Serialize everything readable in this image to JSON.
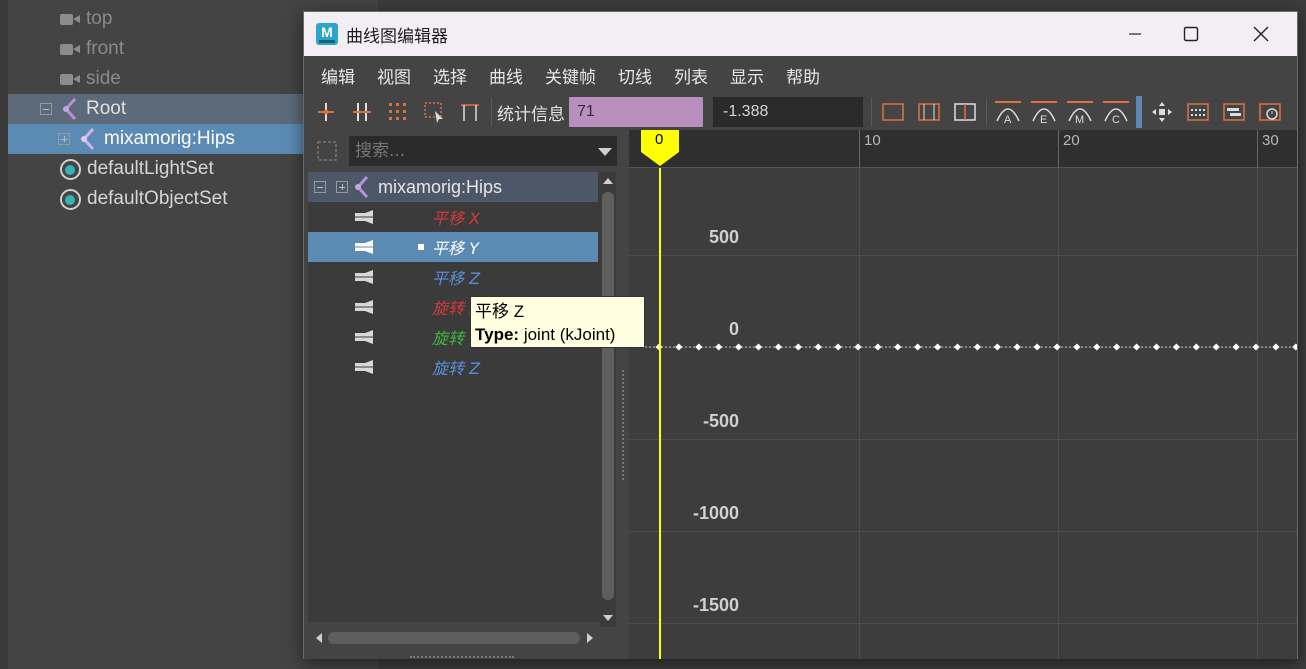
{
  "outliner": {
    "items": [
      {
        "label": "top",
        "kind": "camera"
      },
      {
        "label": "front",
        "kind": "camera"
      },
      {
        "label": "side",
        "kind": "camera"
      },
      {
        "label": "Root",
        "kind": "joint"
      },
      {
        "label": "mixamorig:Hips",
        "kind": "joint"
      },
      {
        "label": "defaultLightSet",
        "kind": "set"
      },
      {
        "label": "defaultObjectSet",
        "kind": "set"
      }
    ]
  },
  "window": {
    "title": "曲线图编辑器",
    "app_icon_letter": "M"
  },
  "menu": [
    "编辑",
    "视图",
    "选择",
    "曲线",
    "关键帧",
    "切线",
    "列表",
    "显示",
    "帮助"
  ],
  "toolbar": {
    "stats_label": "统计信息",
    "frame_value": "71",
    "value_field": "-1.388"
  },
  "search": {
    "placeholder": "搜索..."
  },
  "tree": {
    "node": "mixamorig:Hips",
    "attributes": [
      {
        "label": "平移 X",
        "color": "#d63a3a"
      },
      {
        "label": "平移 Y",
        "color": "#ffffff"
      },
      {
        "label": "平移 Z",
        "color": "#5a8fd6"
      },
      {
        "label": "旋转 X",
        "color": "#d63a3a"
      },
      {
        "label": "旋转 Y",
        "color": "#3fb53f"
      },
      {
        "label": "旋转 Z",
        "color": "#5a8fd6"
      }
    ],
    "selected_index": 1
  },
  "tooltip": {
    "name": "平移 Z",
    "type_label": "Type:",
    "type_value": "joint (kJoint)"
  },
  "graph": {
    "current_frame": "0",
    "ruler_labels": [
      "10",
      "20",
      "30"
    ],
    "y_labels": [
      "500",
      "0",
      "-500",
      "-1000",
      "-1500"
    ],
    "colors": {
      "time_cursor": "#ffff00",
      "curve": "#bfbfbf"
    }
  }
}
